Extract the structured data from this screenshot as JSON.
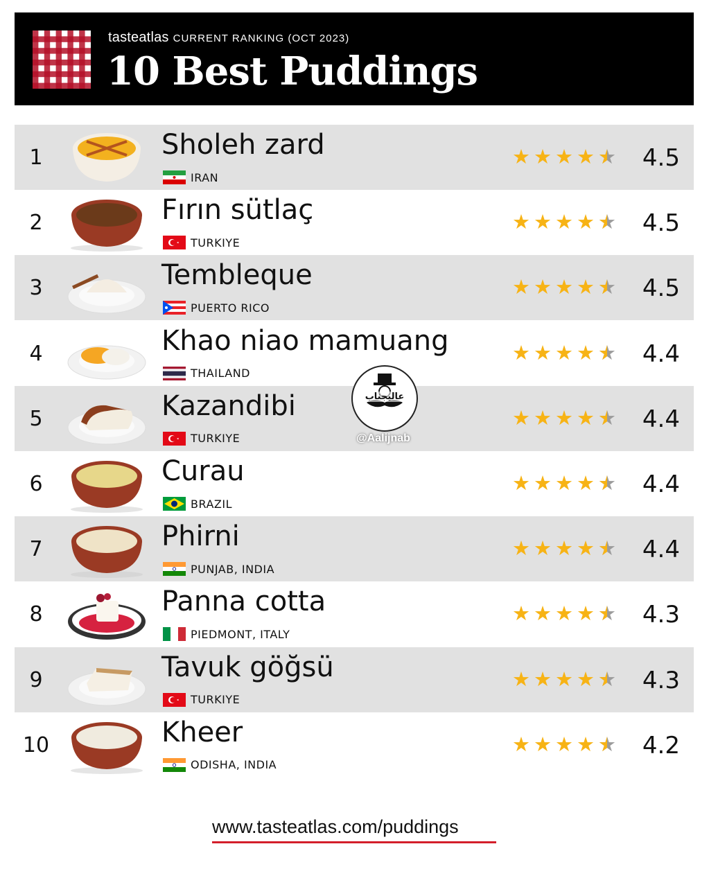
{
  "header": {
    "brand": "tasteatlas",
    "subtitle": "CURRENT RANKING (OCT 2023)",
    "title": "10 Best Puddings"
  },
  "items": [
    {
      "rank": "1",
      "name": "Sholeh zard",
      "country": "IRAN",
      "flag": "iran-flag-icon",
      "dish": "sholeh-zard-image",
      "rating": "4.5",
      "stars": 4.5
    },
    {
      "rank": "2",
      "name": "Fırın sütlaç",
      "country": "TURKIYE",
      "flag": "turkey-flag-icon",
      "dish": "firin-sutlac-image",
      "rating": "4.5",
      "stars": 4.5
    },
    {
      "rank": "3",
      "name": "Tembleque",
      "country": "PUERTO RICO",
      "flag": "puerto-rico-flag-icon",
      "dish": "tembleque-image",
      "rating": "4.5",
      "stars": 4.5
    },
    {
      "rank": "4",
      "name": "Khao niao mamuang",
      "country": "THAILAND",
      "flag": "thailand-flag-icon",
      "dish": "khao-niao-mamuang-image",
      "rating": "4.4",
      "stars": 4.5
    },
    {
      "rank": "5",
      "name": "Kazandibi",
      "country": "TURKIYE",
      "flag": "turkey-flag-icon",
      "dish": "kazandibi-image",
      "rating": "4.4",
      "stars": 4.5
    },
    {
      "rank": "6",
      "name": "Curau",
      "country": "BRAZIL",
      "flag": "brazil-flag-icon",
      "dish": "curau-image",
      "rating": "4.4",
      "stars": 4.5
    },
    {
      "rank": "7",
      "name": "Phirni",
      "country": "PUNJAB, INDIA",
      "flag": "india-flag-icon",
      "dish": "phirni-image",
      "rating": "4.4",
      "stars": 4.5
    },
    {
      "rank": "8",
      "name": "Panna cotta",
      "country": "PIEDMONT, ITALY",
      "flag": "italy-flag-icon",
      "dish": "panna-cotta-image",
      "rating": "4.3",
      "stars": 4.5
    },
    {
      "rank": "9",
      "name": "Tavuk göğsü",
      "country": "TURKIYE",
      "flag": "turkey-flag-icon",
      "dish": "tavuk-gogsu-image",
      "rating": "4.3",
      "stars": 4.5
    },
    {
      "rank": "10",
      "name": "Kheer",
      "country": "ODISHA, INDIA",
      "flag": "india-flag-icon",
      "dish": "kheer-image",
      "rating": "4.2",
      "stars": 4.5
    }
  ],
  "watermark": {
    "handle": "@Aalijnab",
    "logo_text": "عالیجناب"
  },
  "footer": {
    "url": "www.tasteatlas.com/puddings"
  },
  "colors": {
    "header_bg": "#000000",
    "row_shade": "#e1e1e1",
    "star": "#f7b315",
    "star_empty": "#9b9b9b",
    "underline": "#d41f2b"
  }
}
